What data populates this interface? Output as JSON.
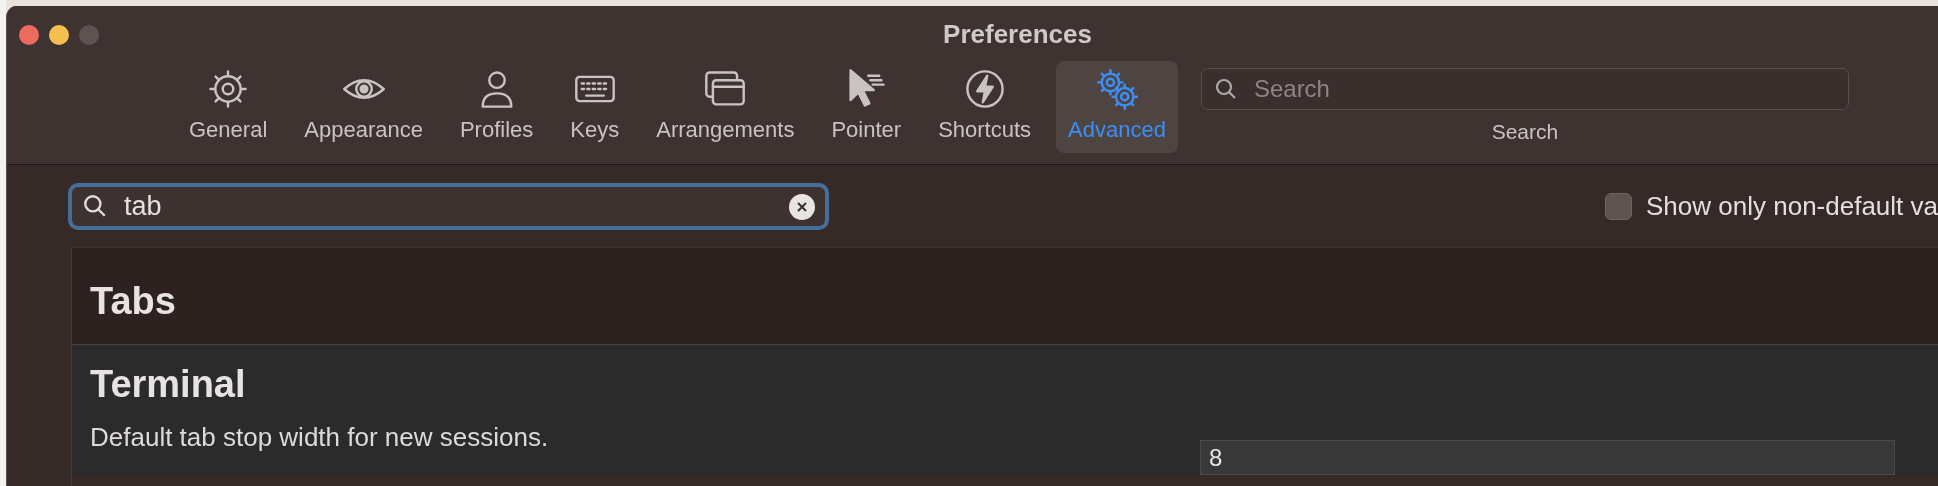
{
  "window": {
    "title": "Preferences"
  },
  "toolbar": {
    "items": [
      {
        "label": "General",
        "selected": false
      },
      {
        "label": "Appearance",
        "selected": false
      },
      {
        "label": "Profiles",
        "selected": false
      },
      {
        "label": "Keys",
        "selected": false
      },
      {
        "label": "Arrangements",
        "selected": false
      },
      {
        "label": "Pointer",
        "selected": false
      },
      {
        "label": "Shortcuts",
        "selected": false
      },
      {
        "label": "Advanced",
        "selected": true
      }
    ],
    "search": {
      "placeholder": "Search",
      "label": "Search"
    }
  },
  "filter": {
    "value": "tab"
  },
  "non_default_checkbox": {
    "label": "Show only non-default va",
    "checked": false
  },
  "sections": [
    {
      "title": "Tabs"
    },
    {
      "title": "Terminal",
      "settings": [
        {
          "label": "Default tab stop width for new sessions.",
          "value": "8"
        }
      ]
    }
  ]
}
